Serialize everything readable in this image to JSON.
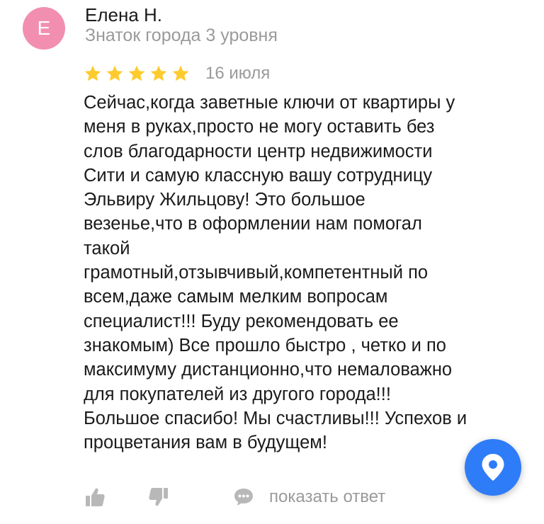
{
  "review": {
    "avatar_letter": "Е",
    "author_name": "Елена Н.",
    "author_level": "Знаток города 3 уровня",
    "rating": 5,
    "rating_max": 5,
    "date": "16 июля",
    "text": "Сейчас,когда заветные ключи от квартиры у\nменя в руках,просто не могу оставить без\nслов благодарности центр недвижимости\nСити и самую классную вашу сотрудницу\nЭльвиру Жильцову! Это большое\nвезенье,что в оформлении нам помогал\nтакой\nграмотный,отзывчивый,компетентный по\nвсем,даже самым мелким вопросам\nспециалист!!! Буду рекомендовать ее\nзнакомым) Все прошло быстро , четко и по\nмаксимуму дистанционно,что немаловажно\nдля покупателей из другого города!!!\nБольшое спасибо! Мы счастливы!!! Успехов и\nпроцветания вам в будущем!"
  },
  "actions": {
    "like_icon": "thumbs-up-icon",
    "dislike_icon": "thumbs-down-icon",
    "reply_icon": "speech-bubble-icon",
    "reply_label": "показать ответ"
  },
  "fab": {
    "icon": "map-pin-icon"
  },
  "colors": {
    "avatar": "#f28fb0",
    "star": "#fecb2f",
    "muted_text": "#9a9a9a",
    "fab": "#2f7cf8",
    "icon_gray": "#b8b8b8"
  }
}
